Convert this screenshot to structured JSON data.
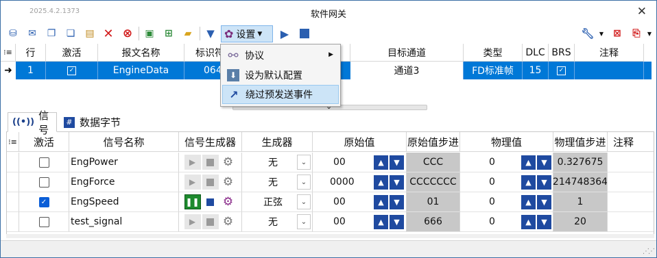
{
  "window": {
    "version": "2025.4.2.1373",
    "title": "软件网关",
    "close_glyph": "✕"
  },
  "toolbar": {
    "settings_label": "设置",
    "icons": [
      "database-add-icon",
      "mail-add-icon",
      "copy-icon",
      "copy-special-icon",
      "paste-icon",
      "delete-x-icon",
      "delete-circle-icon",
      "save-icon",
      "save-as-icon",
      "open-folder-icon",
      "filter-icon",
      "gear-icon",
      "play-icon",
      "stop-icon",
      "wrench-icon",
      "clear-icon",
      "export-icon"
    ]
  },
  "message_table": {
    "headers": [
      "行",
      "激活",
      "报文名称",
      "标识符",
      "",
      "目标通道",
      "类型",
      "DLC",
      "BRS",
      "注释"
    ],
    "selected_row": {
      "row": "1",
      "name": "EngineData",
      "id": "064",
      "target": "通道3",
      "type": "FD标准帧",
      "dlc": "15"
    }
  },
  "settings_menu": {
    "items": [
      "协议",
      "设为默认配置",
      "绕过预发送事件"
    ]
  },
  "tabs": [
    "信号",
    "数据字节"
  ],
  "signal_table": {
    "headers": [
      "激活",
      "信号名称",
      "信号生成器",
      "生成器",
      "原始值",
      "原始值步进",
      "物理值",
      "物理值步进",
      "注释"
    ],
    "rows": [
      {
        "name": "EngPower",
        "active": false,
        "generator": "无",
        "raw": "00",
        "raw_step": "CCC",
        "phys": "0",
        "phys_step": "0.327675",
        "running": false
      },
      {
        "name": "EngForce",
        "active": false,
        "generator": "无",
        "raw": "0000",
        "raw_step": "CCCCCCC",
        "phys": "0",
        "phys_step": "214748364",
        "running": false
      },
      {
        "name": "EngSpeed",
        "active": true,
        "generator": "正弦",
        "raw": "00",
        "raw_step": "01",
        "phys": "0",
        "phys_step": "1",
        "running": true
      },
      {
        "name": "test_signal",
        "active": false,
        "generator": "无",
        "raw": "00",
        "raw_step": "666",
        "phys": "0",
        "phys_step": "20",
        "running": false
      }
    ]
  },
  "colors": {
    "selection": "#0078d7",
    "accent": "#1f4aa0",
    "menu_highlight": "#cce4f7"
  }
}
